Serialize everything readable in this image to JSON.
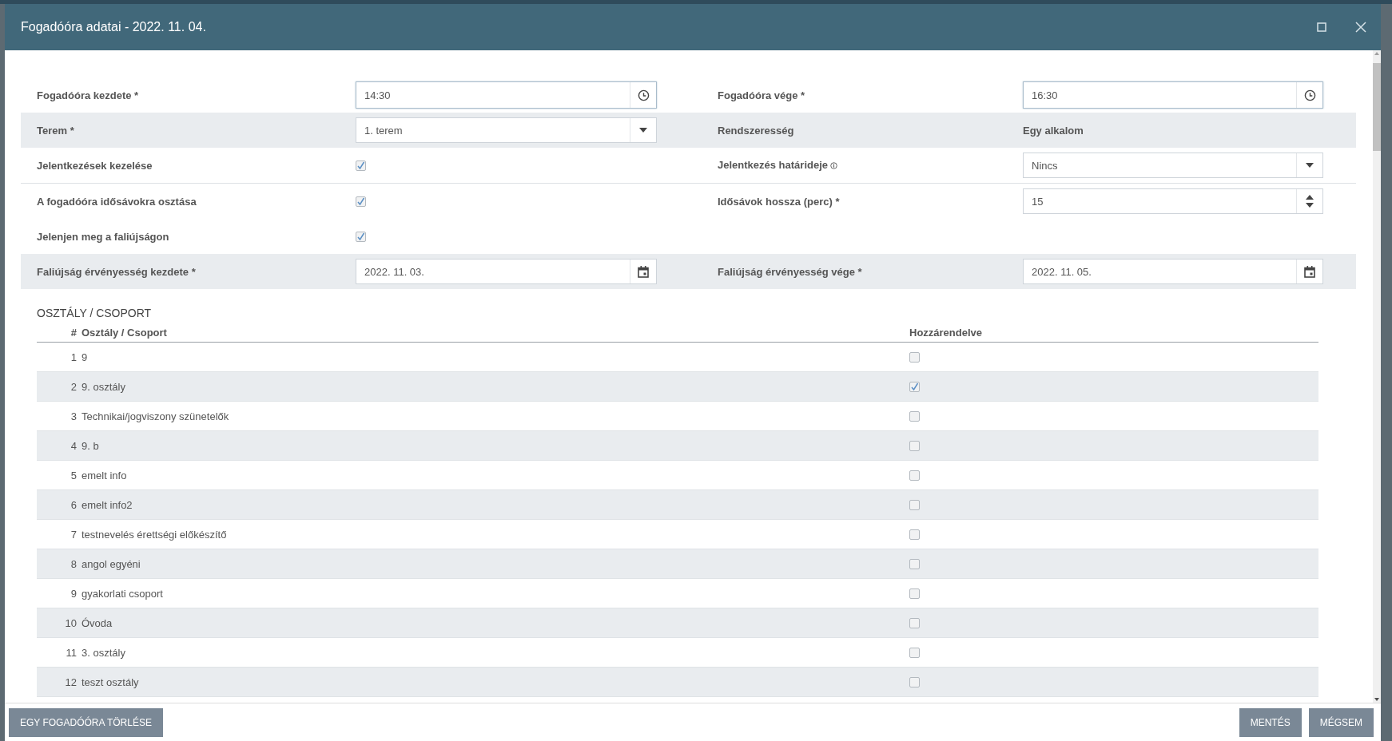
{
  "dialog": {
    "title": "Fogadóóra adatai - 2022. 11. 04."
  },
  "form": {
    "rows": [
      {
        "shaded": false,
        "divider": false,
        "cells": [
          {
            "label": "Fogadóóra kezdete *",
            "control": {
              "kind": "time",
              "value": "14:30"
            }
          },
          {
            "label": "Fogadóóra vége *",
            "control": {
              "kind": "time",
              "value": "16:30"
            }
          }
        ]
      },
      {
        "shaded": true,
        "divider": false,
        "cells": [
          {
            "label": "Terem *",
            "control": {
              "kind": "select",
              "value": "1. terem"
            }
          },
          {
            "label": "Rendszeresség",
            "control": {
              "kind": "text",
              "value": "Egy alkalom"
            }
          }
        ]
      },
      {
        "shaded": false,
        "divider": true,
        "cells": [
          {
            "label": "Jelentkezések kezelése",
            "control": {
              "kind": "checkbox",
              "checked": true
            }
          },
          {
            "label": "Jelentkezés határideje",
            "info": true,
            "control": {
              "kind": "select",
              "value": "Nincs"
            }
          }
        ]
      },
      {
        "shaded": false,
        "divider": false,
        "cells": [
          {
            "label": "A fogadóóra idősávokra osztása",
            "control": {
              "kind": "checkbox",
              "checked": true
            }
          },
          {
            "label": "Idősávok hossza (perc) *",
            "control": {
              "kind": "number",
              "value": "15"
            }
          }
        ]
      },
      {
        "shaded": false,
        "divider": false,
        "cells": [
          {
            "label": "Jelenjen meg a faliújságon",
            "control": {
              "kind": "checkbox",
              "checked": true
            }
          }
        ]
      },
      {
        "shaded": true,
        "divider": false,
        "cells": [
          {
            "label": "Faliújság érvényesség kezdete *",
            "control": {
              "kind": "date",
              "value": "2022. 11. 03."
            }
          },
          {
            "label": "Faliújság érvényesség vége *",
            "control": {
              "kind": "date",
              "value": "2022. 11. 05."
            }
          }
        ]
      }
    ]
  },
  "groups": {
    "title": "OSZTÁLY / CSOPORT",
    "columns": [
      "#",
      "Osztály / Csoport",
      "Hozzárendelve"
    ],
    "rows": [
      {
        "number": "1",
        "name": "9",
        "assigned": false
      },
      {
        "number": "2",
        "name": "9. osztály",
        "assigned": true
      },
      {
        "number": "3",
        "name": "Technikai/jogviszony szünetelők",
        "assigned": false
      },
      {
        "number": "4",
        "name": "9. b",
        "assigned": false
      },
      {
        "number": "5",
        "name": "emelt info",
        "assigned": false
      },
      {
        "number": "6",
        "name": "emelt info2",
        "assigned": false
      },
      {
        "number": "7",
        "name": "testnevelés érettségi előkészítő",
        "assigned": false
      },
      {
        "number": "8",
        "name": "angol egyéni",
        "assigned": false
      },
      {
        "number": "9",
        "name": "gyakorlati csoport",
        "assigned": false
      },
      {
        "number": "10",
        "name": "Óvoda",
        "assigned": false
      },
      {
        "number": "11",
        "name": "3. osztály",
        "assigned": false
      },
      {
        "number": "12",
        "name": "teszt osztály",
        "assigned": false
      }
    ]
  },
  "footer": {
    "left_buttons": [
      "EGY FOGADÓÓRA TÖRLÉSE"
    ],
    "right_buttons": [
      "MENTÉS",
      "MÉGSEM"
    ]
  }
}
